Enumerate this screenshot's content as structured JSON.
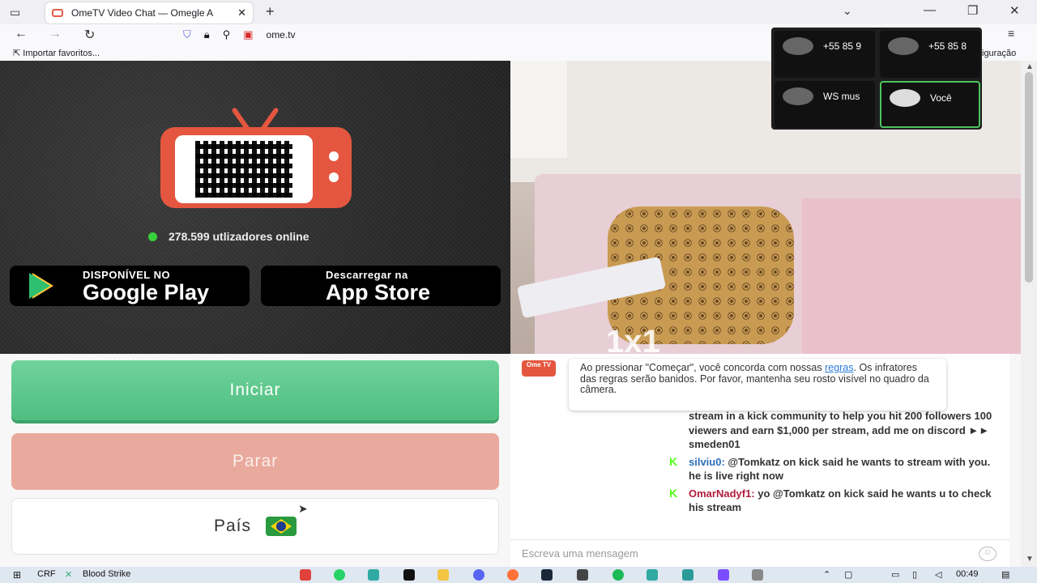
{
  "browser": {
    "tab_title": "OmeTV Video Chat — Omegle A",
    "tab_close": "✕",
    "new_tab": "+",
    "url": "ome.tv",
    "bookmark_import": "Importar favoritos...",
    "bookmark_right": "iguração"
  },
  "hero": {
    "online_text": "278.599 utlizadores online",
    "google_small": "DISPONÍVEL NO",
    "google_big": "Google Play",
    "apple_small": "Descarregar na",
    "apple_big": "App Store"
  },
  "video": {
    "watermark": "1x1"
  },
  "controls": {
    "start_label": "Iniciar",
    "stop_label": "Parar",
    "country_label": "País"
  },
  "chat": {
    "logo_text": "Ome TV",
    "notice_pre": "Ao pressionar \"Começar\", você concorda com nossas ",
    "notice_link": "regras",
    "notice_post": ". Os infratores das regras serão banidos. Por favor, mantenha seu rosto visível no quadro da câmera.",
    "messages": [
      {
        "user": "",
        "text": "stream in a kick community to help you hit 200 followers 100 viewers and earn $1,000 per stream, add me on discord ►► smeden01"
      },
      {
        "user": "silviu0:",
        "text": " @Tomkatz on kick said he wants to stream with you. he is live right now"
      },
      {
        "user": "OmarNadyf1:",
        "text": " yo @Tomkatz on kick said he wants u to check his stream"
      }
    ],
    "input_placeholder": "Escreva uma mensagem"
  },
  "overlay": {
    "participants": [
      "+55 85 9",
      "+55 85 8",
      "WS mus",
      "Você"
    ]
  },
  "taskbar": {
    "crf": "CRF",
    "game": "Blood Strike",
    "time": "00:49"
  }
}
